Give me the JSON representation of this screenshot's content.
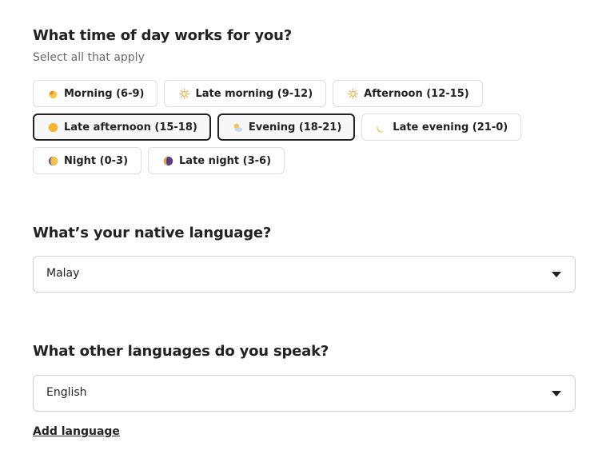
{
  "time_of_day": {
    "title": "What time of day works for you?",
    "subtitle": "Select all that apply",
    "options": [
      {
        "label": "Morning (6-9)",
        "icon": "sunrise-icon",
        "selected": false
      },
      {
        "label": "Late morning (9-12)",
        "icon": "sun-icon",
        "selected": false
      },
      {
        "label": "Afternoon (12-15)",
        "icon": "sun-icon",
        "selected": false
      },
      {
        "label": "Late afternoon (15-18)",
        "icon": "sun-full-icon",
        "selected": true
      },
      {
        "label": "Evening (18-21)",
        "icon": "sun-behind-cloud-icon",
        "selected": true
      },
      {
        "label": "Late evening (21-0)",
        "icon": "crescent-moon-icon",
        "selected": false
      },
      {
        "label": "Night (0-3)",
        "icon": "waning-moon-icon",
        "selected": false
      },
      {
        "label": "Late night (3-6)",
        "icon": "new-moon-icon",
        "selected": false
      }
    ]
  },
  "native_language": {
    "title": "What’s your native language?",
    "value": "Malay"
  },
  "other_languages": {
    "title": "What other languages do you speak?",
    "value": "English",
    "add_label": "Add language"
  },
  "colors": {
    "text": "#222222",
    "muted": "#6a6a6a",
    "border": "#dddddd",
    "selected_border": "#222222"
  }
}
